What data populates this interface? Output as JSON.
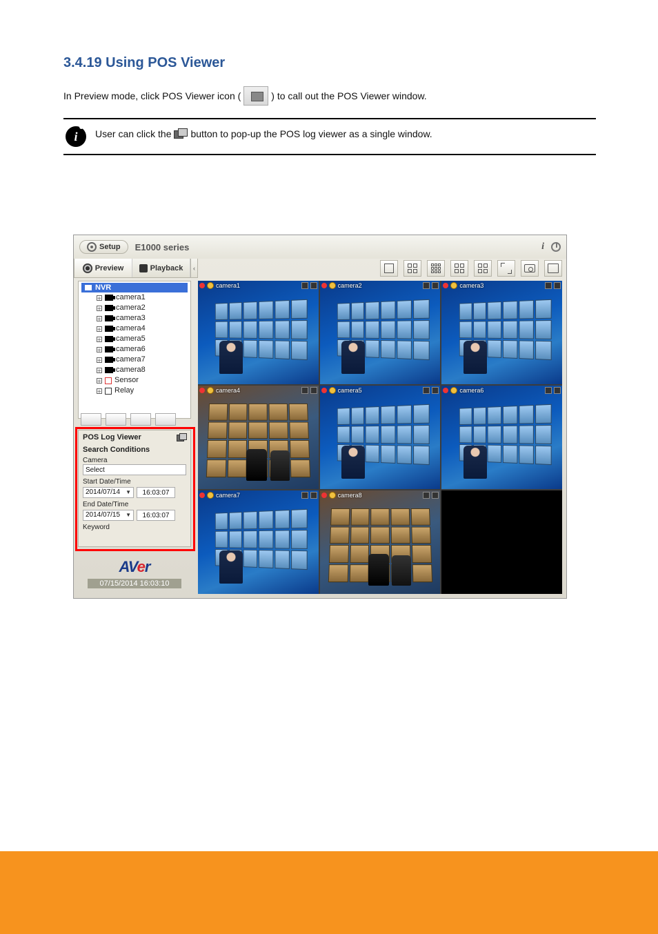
{
  "doc": {
    "heading": "3.4.19 Using POS Viewer",
    "instr_part1": "In Preview mode, click POS Viewer icon (",
    "instr_part2": ") to call out the POS Viewer window.",
    "note_part1": "User can click the ",
    "note_part2": " button to pop-up the POS log viewer as a single window."
  },
  "titlebar": {
    "setup_label": "Setup",
    "series": "E1000 series"
  },
  "mode": {
    "preview": "Preview",
    "playback": "Playback",
    "collapse_glyph": "‹"
  },
  "tree": {
    "root": "NVR",
    "items": [
      {
        "label": "camera1",
        "type": "camera"
      },
      {
        "label": "camera2",
        "type": "camera"
      },
      {
        "label": "camera3",
        "type": "camera"
      },
      {
        "label": "camera4",
        "type": "camera"
      },
      {
        "label": "camera5",
        "type": "camera"
      },
      {
        "label": "camera6",
        "type": "camera"
      },
      {
        "label": "camera7",
        "type": "camera"
      },
      {
        "label": "camera8",
        "type": "camera"
      },
      {
        "label": "Sensor",
        "type": "sensor"
      },
      {
        "label": "Relay",
        "type": "relay"
      }
    ]
  },
  "pos": {
    "title": "POS Log Viewer",
    "section": "Search Conditions",
    "camera_label": "Camera",
    "camera_value": "Select",
    "start_label": "Start Date/Time",
    "start_date": "2014/07/14",
    "start_time": "16:03:07",
    "end_label": "End Date/Time",
    "end_date": "2014/07/15",
    "end_time": "16:03:07",
    "keyword_label": "Keyword"
  },
  "logo": {
    "brand_prefix": "AV",
    "brand_accent": "e",
    "brand_suffix": "r",
    "datetime": "07/15/2014 16:03:10"
  },
  "cameras": [
    {
      "name": "camera1",
      "scene": "office"
    },
    {
      "name": "camera2",
      "scene": "office"
    },
    {
      "name": "camera3",
      "scene": "office"
    },
    {
      "name": "camera4",
      "scene": "store"
    },
    {
      "name": "camera5",
      "scene": "office"
    },
    {
      "name": "camera6",
      "scene": "office"
    },
    {
      "name": "camera7",
      "scene": "office"
    },
    {
      "name": "camera8",
      "scene": "store"
    },
    {
      "name": "",
      "scene": "black"
    }
  ]
}
